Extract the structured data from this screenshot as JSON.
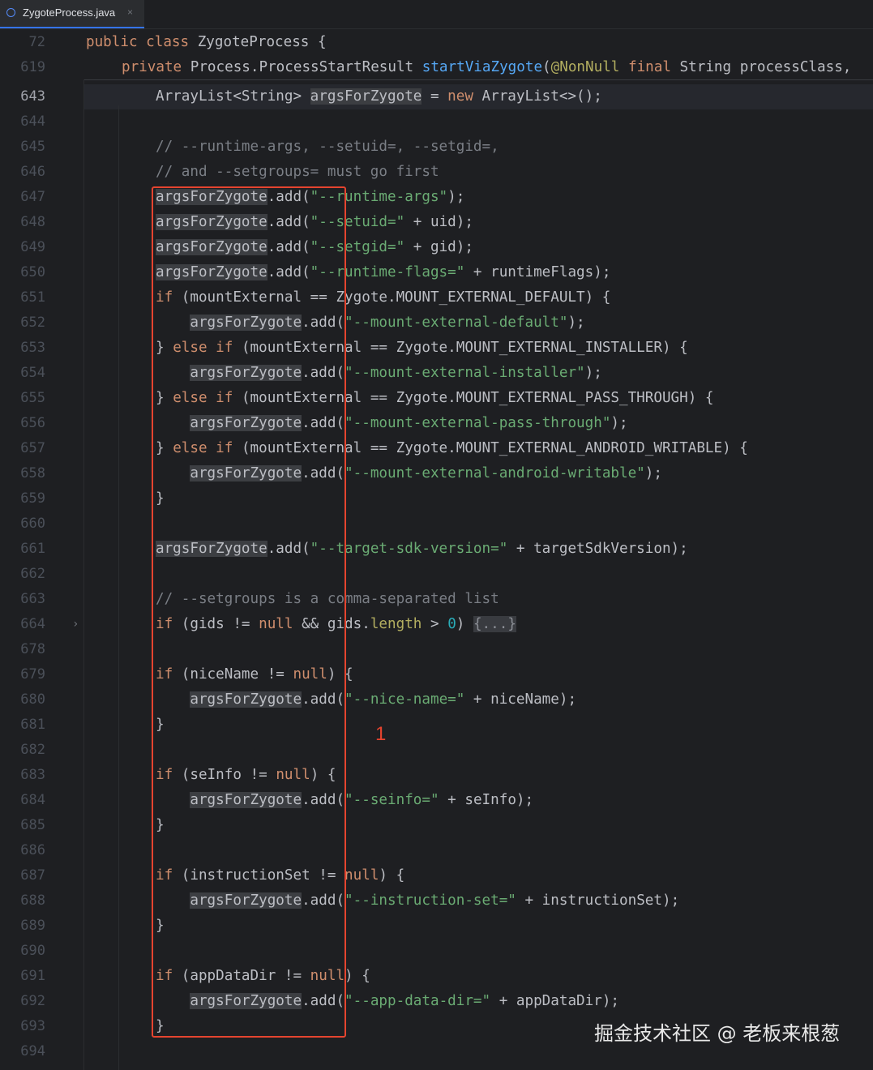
{
  "tab": {
    "label": "ZygoteProcess.java",
    "close": "×",
    "icon": "java-class-icon"
  },
  "sticky_lines": [
    {
      "num": "72",
      "tokens": [
        [
          "kw",
          "public class "
        ],
        [
          "",
          "ZygoteProcess {"
        ]
      ]
    },
    {
      "num": "619",
      "tokens": [
        [
          "kw",
          "private "
        ],
        [
          "",
          "Process.ProcessStartResult "
        ],
        [
          "fn",
          "startViaZygote"
        ],
        [
          "",
          "("
        ],
        [
          "ann",
          "@NonNull "
        ],
        [
          "kw",
          "final "
        ],
        [
          "",
          "String processClass,"
        ]
      ]
    }
  ],
  "lines": [
    {
      "num": "643",
      "tokens": [
        [
          "",
          "ArrayList<String> "
        ],
        [
          "hl",
          "argsForZygote"
        ],
        [
          "",
          " = "
        ],
        [
          "kw",
          "new "
        ],
        [
          "",
          "ArrayList<>();"
        ]
      ]
    },
    {
      "num": "644",
      "tokens": []
    },
    {
      "num": "645",
      "tokens": [
        [
          "cm",
          "// --runtime-args, --setuid=, --setgid=,"
        ]
      ]
    },
    {
      "num": "646",
      "tokens": [
        [
          "cm",
          "// and --setgroups= must go first"
        ]
      ]
    },
    {
      "num": "647",
      "tokens": [
        [
          "hl",
          "argsForZygote"
        ],
        [
          "",
          ".add("
        ],
        [
          "str",
          "\"--runtime-args\""
        ],
        [
          "",
          ");"
        ]
      ]
    },
    {
      "num": "648",
      "tokens": [
        [
          "hl",
          "argsForZygote"
        ],
        [
          "",
          ".add("
        ],
        [
          "str",
          "\"--setuid=\""
        ],
        [
          "",
          " + uid);"
        ]
      ]
    },
    {
      "num": "649",
      "tokens": [
        [
          "hl",
          "argsForZygote"
        ],
        [
          "",
          ".add("
        ],
        [
          "str",
          "\"--setgid=\""
        ],
        [
          "",
          " + gid);"
        ]
      ]
    },
    {
      "num": "650",
      "tokens": [
        [
          "hl",
          "argsForZygote"
        ],
        [
          "",
          ".add("
        ],
        [
          "str",
          "\"--runtime-flags=\""
        ],
        [
          "",
          " + runtimeFlags);"
        ]
      ]
    },
    {
      "num": "651",
      "tokens": [
        [
          "kw",
          "if "
        ],
        [
          "",
          "(mountExternal == Zygote.MOUNT_EXTERNAL_DEFAULT) {"
        ]
      ]
    },
    {
      "num": "652",
      "tokens": [
        [
          "",
          "    "
        ],
        [
          "hl",
          "argsForZygote"
        ],
        [
          "",
          ".add("
        ],
        [
          "str",
          "\"--mount-external-default\""
        ],
        [
          "",
          ");"
        ]
      ]
    },
    {
      "num": "653",
      "tokens": [
        [
          "",
          "} "
        ],
        [
          "kw",
          "else if "
        ],
        [
          "",
          "(mountExternal == Zygote.MOUNT_EXTERNAL_INSTALLER) {"
        ]
      ]
    },
    {
      "num": "654",
      "tokens": [
        [
          "",
          "    "
        ],
        [
          "hl",
          "argsForZygote"
        ],
        [
          "",
          ".add("
        ],
        [
          "str",
          "\"--mount-external-installer\""
        ],
        [
          "",
          ");"
        ]
      ]
    },
    {
      "num": "655",
      "tokens": [
        [
          "",
          "} "
        ],
        [
          "kw",
          "else if "
        ],
        [
          "",
          "(mountExternal == Zygote.MOUNT_EXTERNAL_PASS_THROUGH) {"
        ]
      ]
    },
    {
      "num": "656",
      "tokens": [
        [
          "",
          "    "
        ],
        [
          "hl",
          "argsForZygote"
        ],
        [
          "",
          ".add("
        ],
        [
          "str",
          "\"--mount-external-pass-through\""
        ],
        [
          "",
          ");"
        ]
      ]
    },
    {
      "num": "657",
      "tokens": [
        [
          "",
          "} "
        ],
        [
          "kw",
          "else if "
        ],
        [
          "",
          "(mountExternal == Zygote.MOUNT_EXTERNAL_ANDROID_WRITABLE) {"
        ]
      ]
    },
    {
      "num": "658",
      "tokens": [
        [
          "",
          "    "
        ],
        [
          "hl",
          "argsForZygote"
        ],
        [
          "",
          ".add("
        ],
        [
          "str",
          "\"--mount-external-android-writable\""
        ],
        [
          "",
          ");"
        ]
      ]
    },
    {
      "num": "659",
      "tokens": [
        [
          "",
          "}"
        ]
      ]
    },
    {
      "num": "660",
      "tokens": []
    },
    {
      "num": "661",
      "tokens": [
        [
          "hl",
          "argsForZygote"
        ],
        [
          "",
          ".add("
        ],
        [
          "str",
          "\"--target-sdk-version=\""
        ],
        [
          "",
          " + targetSdkVersion);"
        ]
      ]
    },
    {
      "num": "662",
      "tokens": []
    },
    {
      "num": "663",
      "tokens": [
        [
          "cm",
          "// --setgroups is a comma-separated list"
        ]
      ]
    },
    {
      "num": "664",
      "tokens": [
        [
          "kw",
          "if "
        ],
        [
          "",
          "(gids != "
        ],
        [
          "kw",
          "null "
        ],
        [
          "",
          "&& gids."
        ],
        [
          "ann",
          "length"
        ],
        [
          "",
          " > "
        ],
        [
          "num",
          "0"
        ],
        [
          "",
          ") "
        ],
        [
          "fold",
          "{...}"
        ]
      ]
    },
    {
      "num": "678",
      "tokens": []
    },
    {
      "num": "679",
      "tokens": [
        [
          "kw",
          "if "
        ],
        [
          "",
          "(niceName != "
        ],
        [
          "kw",
          "null"
        ],
        [
          "",
          ") {"
        ]
      ]
    },
    {
      "num": "680",
      "tokens": [
        [
          "",
          "    "
        ],
        [
          "hl",
          "argsForZygote"
        ],
        [
          "",
          ".add("
        ],
        [
          "str",
          "\"--nice-name=\""
        ],
        [
          "",
          " + niceName);"
        ]
      ]
    },
    {
      "num": "681",
      "tokens": [
        [
          "",
          "}"
        ]
      ]
    },
    {
      "num": "682",
      "tokens": []
    },
    {
      "num": "683",
      "tokens": [
        [
          "kw",
          "if "
        ],
        [
          "",
          "(seInfo != "
        ],
        [
          "kw",
          "null"
        ],
        [
          "",
          ") {"
        ]
      ]
    },
    {
      "num": "684",
      "tokens": [
        [
          "",
          "    "
        ],
        [
          "hl",
          "argsForZygote"
        ],
        [
          "",
          ".add("
        ],
        [
          "str",
          "\"--seinfo=\""
        ],
        [
          "",
          " + seInfo);"
        ]
      ]
    },
    {
      "num": "685",
      "tokens": [
        [
          "",
          "}"
        ]
      ]
    },
    {
      "num": "686",
      "tokens": []
    },
    {
      "num": "687",
      "tokens": [
        [
          "kw",
          "if "
        ],
        [
          "",
          "(instructionSet != "
        ],
        [
          "kw",
          "null"
        ],
        [
          "",
          ") {"
        ]
      ]
    },
    {
      "num": "688",
      "tokens": [
        [
          "",
          "    "
        ],
        [
          "hl",
          "argsForZygote"
        ],
        [
          "",
          ".add("
        ],
        [
          "str",
          "\"--instruction-set=\""
        ],
        [
          "",
          " + instructionSet);"
        ]
      ]
    },
    {
      "num": "689",
      "tokens": [
        [
          "",
          "}"
        ]
      ]
    },
    {
      "num": "690",
      "tokens": []
    },
    {
      "num": "691",
      "tokens": [
        [
          "kw",
          "if "
        ],
        [
          "",
          "(appDataDir != "
        ],
        [
          "kw",
          "null"
        ],
        [
          "",
          ") {"
        ]
      ]
    },
    {
      "num": "692",
      "tokens": [
        [
          "",
          "    "
        ],
        [
          "hl",
          "argsForZygote"
        ],
        [
          "",
          ".add("
        ],
        [
          "str",
          "\"--app-data-dir=\""
        ],
        [
          "",
          " + appDataDir);"
        ]
      ]
    },
    {
      "num": "693",
      "tokens": [
        [
          "",
          "}"
        ]
      ]
    },
    {
      "num": "694",
      "tokens": []
    }
  ],
  "annotation": {
    "mark": "1",
    "color": "#e5442f"
  },
  "watermark": "掘金技术社区 @ 老板来根葱"
}
